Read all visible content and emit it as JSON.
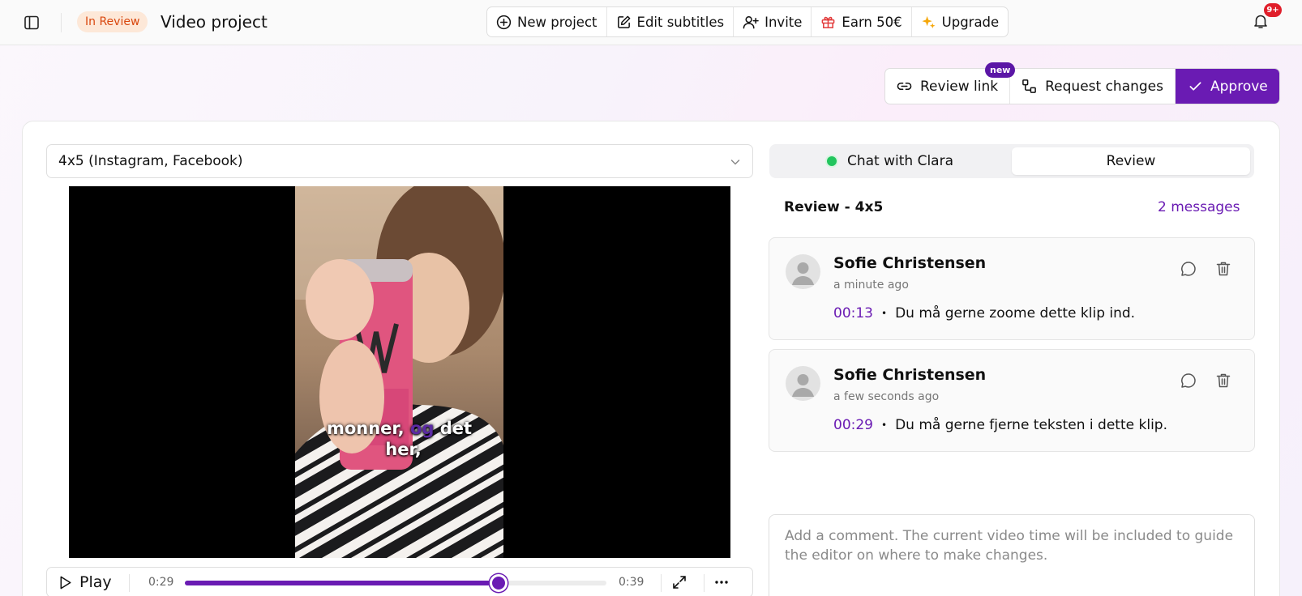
{
  "header": {
    "status": "In Review",
    "title": "Video project",
    "actions": [
      {
        "label": "New project",
        "icon": "plus-circle-icon"
      },
      {
        "label": "Edit subtitles",
        "icon": "edit-icon"
      },
      {
        "label": "Invite",
        "icon": "user-plus-icon"
      },
      {
        "label": "Earn 50€",
        "icon": "gift-icon"
      },
      {
        "label": "Upgrade",
        "icon": "sparkle-icon"
      }
    ],
    "notification_count": "9+"
  },
  "review_actions": {
    "review_link": "Review link",
    "new_badge": "new",
    "request_changes": "Request changes",
    "approve": "Approve"
  },
  "video": {
    "format": "4x5 (Instagram, Facebook)",
    "subtitle_line1_a": "monner,",
    "subtitle_line1_b": "og",
    "subtitle_line1_c": "det",
    "subtitle_line2": "her,"
  },
  "player": {
    "play_label": "Play",
    "current_time": "0:29",
    "duration": "0:39",
    "progress": 0.744
  },
  "panel": {
    "tabs": [
      "Chat with Clara",
      "Review"
    ],
    "active_tab": "Review",
    "heading": "Review - 4x5",
    "message_count": "2 messages",
    "comments": [
      {
        "author": "Sofie Christensen",
        "ago": "a minute ago",
        "time": "00:13",
        "text": "Du må gerne zoome dette klip ind."
      },
      {
        "author": "Sofie Christensen",
        "ago": "a few seconds ago",
        "time": "00:29",
        "text": "Du må gerne fjerne teksten i dette klip."
      }
    ],
    "input_placeholder": "Add a comment. The current video time will be included to guide the editor on where to make changes."
  },
  "colors": {
    "accent": "#6a1bb3",
    "status_bg": "#fde8d8",
    "status_text": "#d9480f",
    "online": "#22c55e",
    "notification": "#e01e2a"
  }
}
